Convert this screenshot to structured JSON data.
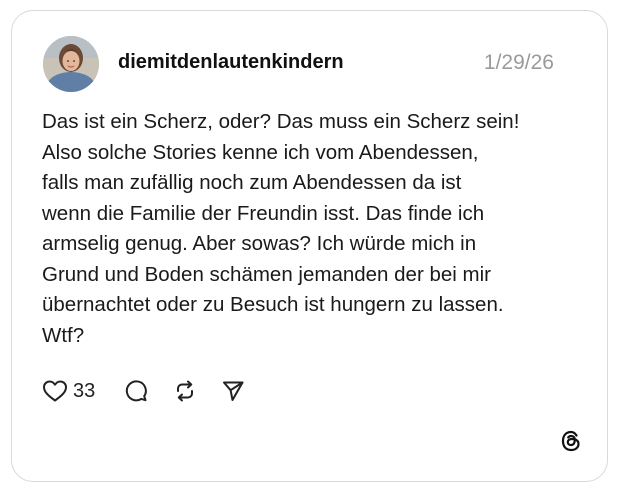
{
  "post": {
    "username": "diemitdenlautenkindern",
    "date": "1/29/26",
    "text_lines": [
      "Das ist ein Scherz, oder? Das muss ein Scherz sein!",
      "Also solche Stories kenne ich vom Abendessen,",
      "falls man zufällig noch zum Abendessen da ist",
      "wenn die Familie der Freundin isst. Das finde ich",
      "armselig genug. Aber sowas? Ich würde mich in",
      "Grund und Boden schämen jemanden der bei mir",
      "übernachtet oder zu Besuch ist hungern zu lassen.",
      "Wtf?"
    ]
  },
  "actions": {
    "like_count": "33",
    "icons": [
      "heart-icon",
      "comment-icon",
      "repost-icon",
      "share-icon"
    ]
  },
  "branding": {
    "logo": "threads-logo-icon"
  },
  "colors": {
    "border": "#d9d9d9",
    "text": "#1a1a1a",
    "date": "#9a9a9a"
  }
}
